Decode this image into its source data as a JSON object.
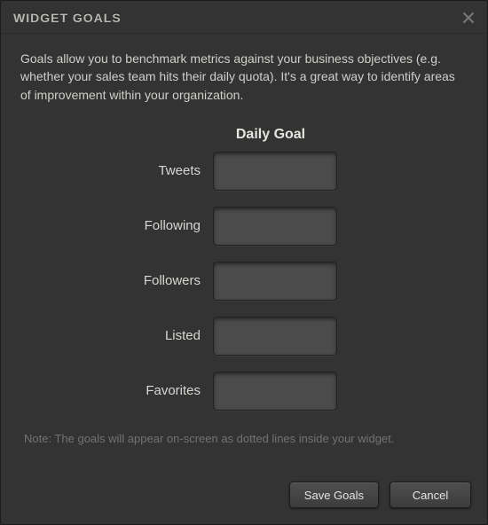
{
  "dialog": {
    "title": "WIDGET GOALS",
    "description": "Goals allow you to benchmark metrics against your business objectives (e.g. whether your sales team hits their daily quota). It's a great way to identify areas of improvement within your organization.",
    "column_header": "Daily Goal",
    "fields": {
      "tweets": {
        "label": "Tweets",
        "value": ""
      },
      "following": {
        "label": "Following",
        "value": ""
      },
      "followers": {
        "label": "Followers",
        "value": ""
      },
      "listed": {
        "label": "Listed",
        "value": ""
      },
      "favorites": {
        "label": "Favorites",
        "value": ""
      }
    },
    "note": "Note: The goals will appear on-screen as dotted lines inside your widget.",
    "buttons": {
      "save": "Save Goals",
      "cancel": "Cancel"
    }
  }
}
